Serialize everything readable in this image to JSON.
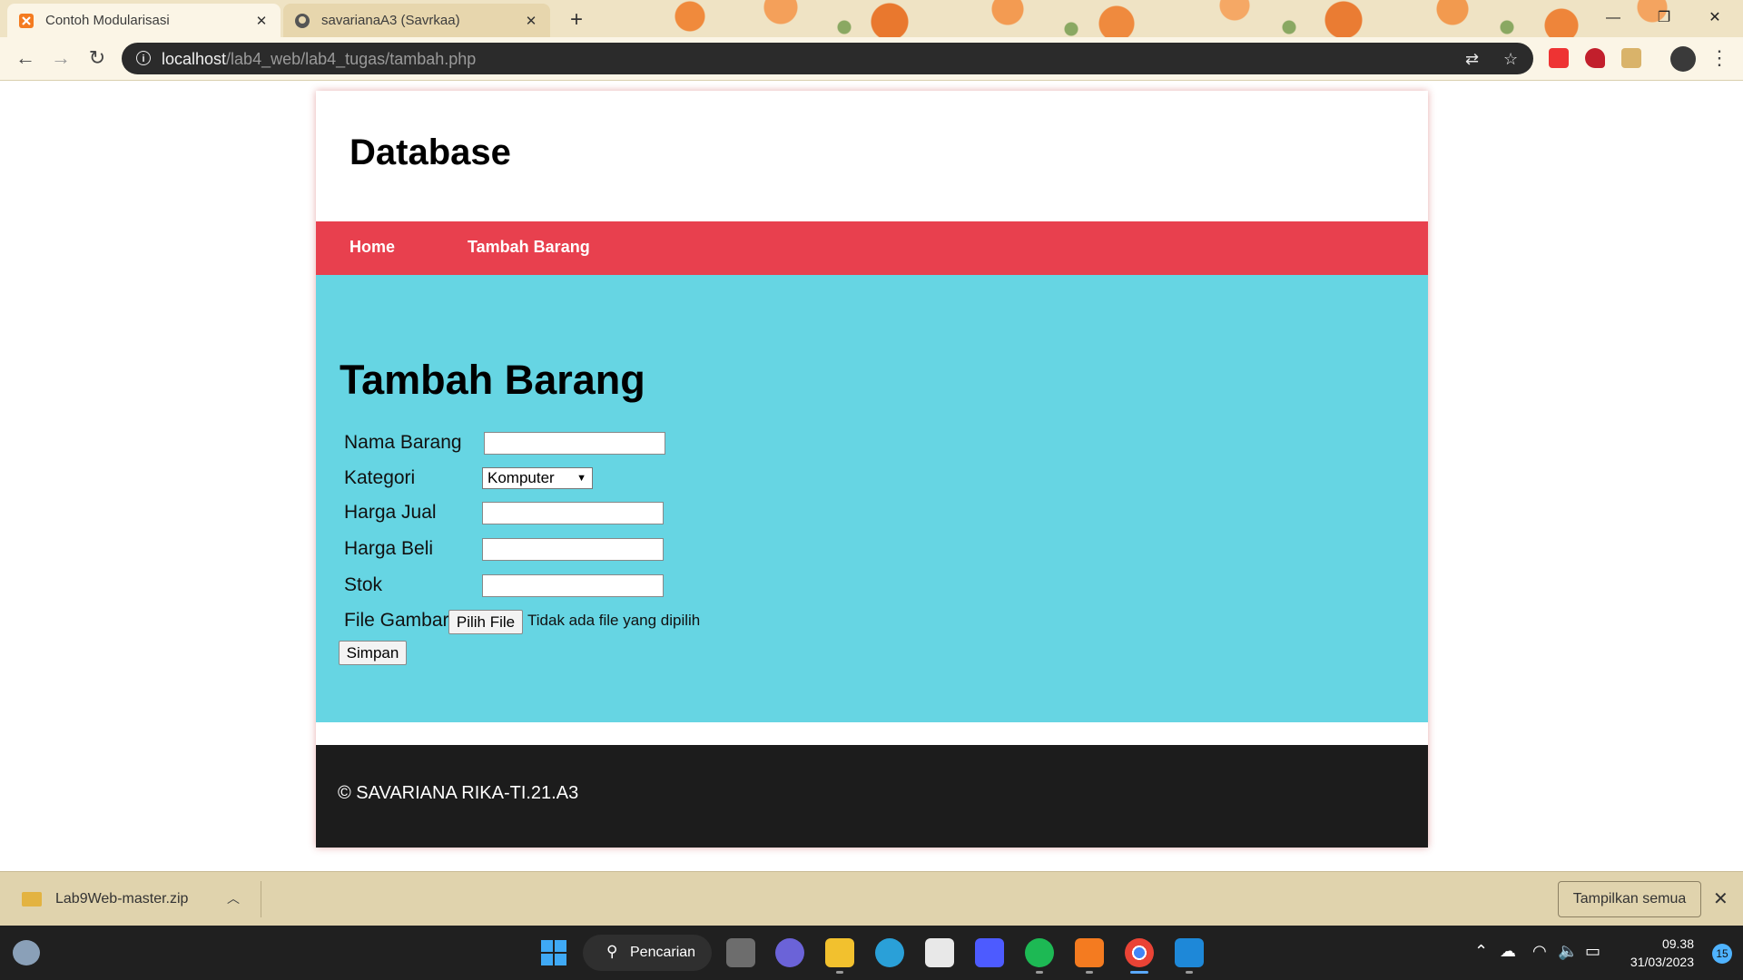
{
  "browser": {
    "tabs": [
      {
        "title": "Contoh Modularisasi",
        "active": true
      },
      {
        "title": "savarianaA3 (Savrkaa)",
        "active": false
      }
    ],
    "url_host": "localhost",
    "url_path": "/lab4_web/lab4_tugas/tambah.php"
  },
  "page": {
    "site_title": "Database",
    "nav": [
      "Home",
      "Tambah Barang"
    ],
    "heading": "Tambah Barang",
    "form": {
      "labels": {
        "nama": "Nama Barang",
        "kategori": "Kategori",
        "harga_jual": "Harga Jual",
        "harga_beli": "Harga Beli",
        "stok": "Stok",
        "file": "File Gambar"
      },
      "kategori_selected": "Komputer",
      "file_button": "Pilih File",
      "file_status": "Tidak ada file yang dipilih",
      "submit": "Simpan"
    },
    "footer": "© SAVARIANA RIKA-TI.21.A3"
  },
  "downloads": {
    "file": "Lab9Web-master.zip",
    "show_all": "Tampilkan semua"
  },
  "taskbar": {
    "search": "Pencarian",
    "time": "09.38",
    "date": "31/03/2023",
    "notifications": "15"
  },
  "colors": {
    "nav": "#e8404e",
    "content": "#66d5e3",
    "footer": "#1c1c1c"
  }
}
